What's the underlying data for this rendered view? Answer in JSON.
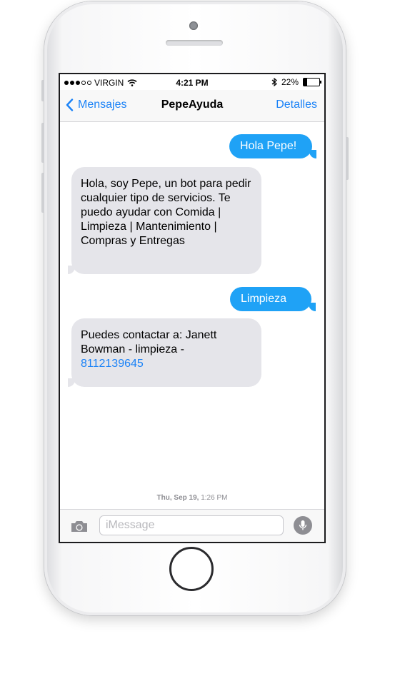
{
  "status_bar": {
    "carrier": "VIRGIN",
    "time": "4:21 PM",
    "battery_percent_label": "22%",
    "battery_level": 0.22,
    "signal_bars_filled": 3,
    "signal_bars_total": 5
  },
  "nav": {
    "back_label": "Mensajes",
    "title": "PepeAyuda",
    "details_label": "Detalles"
  },
  "messages": [
    {
      "direction": "outgoing",
      "text": "Hola Pepe!"
    },
    {
      "direction": "incoming",
      "text": "Hola, soy Pepe, un bot para pedir cualquier tipo de servicios. Te puedo ayudar con Comida | Limpieza | Mantenimiento | Compras y Entregas"
    },
    {
      "direction": "outgoing",
      "text": "Limpieza"
    },
    {
      "direction": "incoming",
      "text": "Puedes contactar a: Janett Bowman - limpieza -",
      "link": "8112139645"
    }
  ],
  "timestamp": {
    "day": "Thu, Sep 19,",
    "time": "1:26 PM"
  },
  "input": {
    "placeholder": "iMessage"
  },
  "icons": {
    "back": "chevron-left-icon",
    "wifi": "wifi-icon",
    "bluetooth": "bluetooth-icon",
    "camera": "camera-icon",
    "microphone": "microphone-icon"
  },
  "colors": {
    "accent": "#1a82f7",
    "outgoing_bubble": "#1fa2f6",
    "incoming_bubble": "#e5e5ea"
  }
}
